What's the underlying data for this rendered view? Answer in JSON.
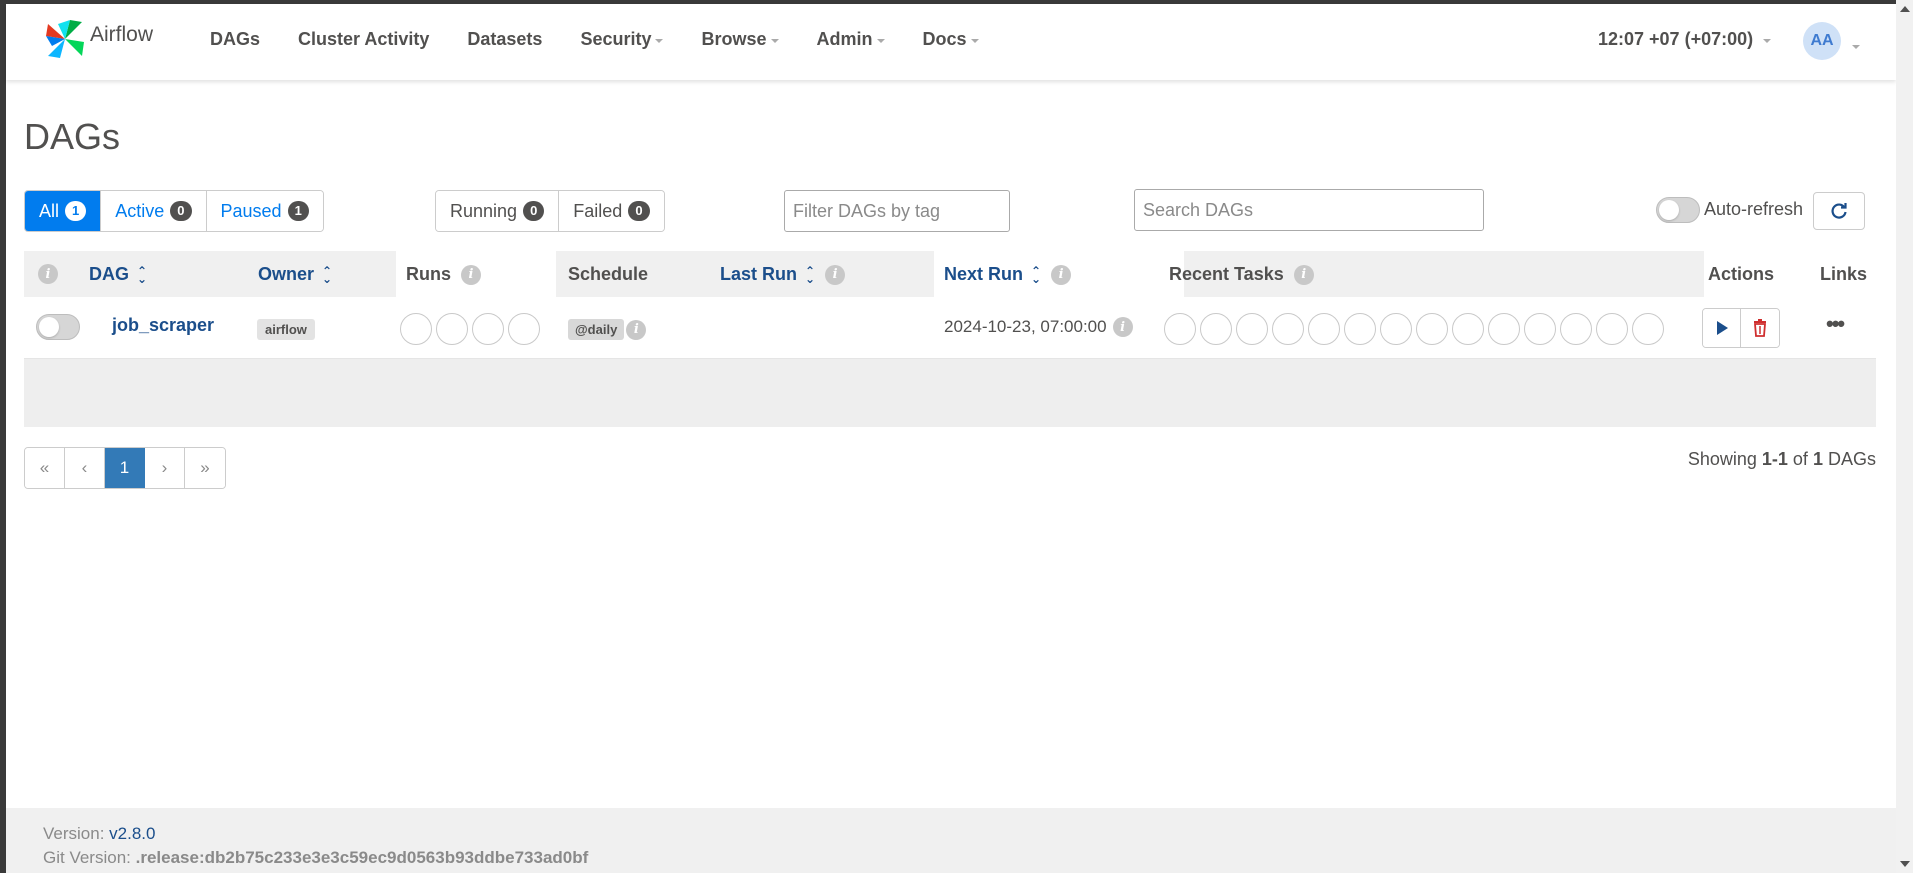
{
  "app": {
    "name": "Airflow"
  },
  "nav": {
    "items": [
      "DAGs",
      "Cluster Activity",
      "Datasets",
      "Security",
      "Browse",
      "Admin",
      "Docs"
    ],
    "time": "12:07 +07 (+07:00)",
    "user_initials": "AA"
  },
  "page": {
    "title": "DAGs"
  },
  "filters": {
    "all_label": "All",
    "all_count": "1",
    "active_label": "Active",
    "active_count": "0",
    "paused_label": "Paused",
    "paused_count": "1",
    "running_label": "Running",
    "running_count": "0",
    "failed_label": "Failed",
    "failed_count": "0",
    "tag_placeholder": "Filter DAGs by tag",
    "search_placeholder": "Search DAGs",
    "auto_refresh_label": "Auto-refresh"
  },
  "table": {
    "columns": {
      "dag": "DAG",
      "owner": "Owner",
      "runs": "Runs",
      "schedule": "Schedule",
      "last_run": "Last Run",
      "next_run": "Next Run",
      "recent_tasks": "Recent Tasks",
      "actions": "Actions",
      "links": "Links"
    },
    "rows": [
      {
        "dag_id": "job_scraper",
        "owner": "airflow",
        "schedule": "@daily",
        "last_run": "",
        "next_run": "2024-10-23, 07:00:00",
        "paused": true
      }
    ]
  },
  "pagination": {
    "first": "«",
    "prev": "‹",
    "current": "1",
    "next": "›",
    "last": "»",
    "showing_prefix": "Showing",
    "showing_range": "1-1",
    "showing_of": "of",
    "showing_total": "1",
    "showing_suffix": "DAGs"
  },
  "footer": {
    "version_label": "Version:",
    "version": "v2.8.0",
    "git_label": "Git Version:",
    "git_version": ".release:db2b75c233e3e3c59ec9d0563b93ddbe733ad0bf"
  },
  "colors": {
    "accent": "#017cee",
    "link": "#1b4e8b",
    "delete": "#cf2e2e"
  }
}
